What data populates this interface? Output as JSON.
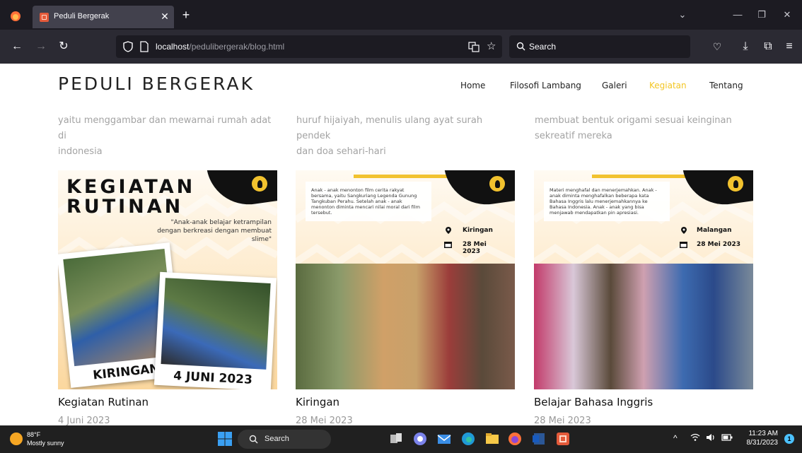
{
  "browser": {
    "tab_title": "Peduli Bergerak",
    "url_host": "localhost",
    "url_path": "/pedulibergerak/blog.html",
    "search_placeholder": "Search"
  },
  "site": {
    "brand": "PEDULI BERGERAK",
    "nav": [
      {
        "label": "Home",
        "active": false
      },
      {
        "label": "Filosofi Lambang",
        "active": false
      },
      {
        "label": "Galeri",
        "active": false
      },
      {
        "label": "Kegiatan",
        "active": true
      },
      {
        "label": "Tentang",
        "active": false
      }
    ],
    "prev_texts": [
      [
        "yaitu menggambar dan mewarnai rumah adat di",
        "indonesia"
      ],
      [
        "huruf hijaiyah, menulis ulang ayat surah pendek",
        "dan doa sehari-hari"
      ],
      [
        "membuat bentuk origami sesuai keinginan",
        "sekreatif mereka"
      ]
    ],
    "cards": [
      {
        "title": "Kegiatan Rutinan",
        "date": "4 Juni 2023",
        "poster": {
          "heading_1": "KEGIATAN",
          "heading_2": "RUTINAN",
          "quote": "\"Anak-anak belajar ketrampilan dengan berkreasi dengan membuat slime\"",
          "caption_left": "KIRINGAN",
          "caption_right": "4 JUNI 2023"
        }
      },
      {
        "title": "Kiringan",
        "date": "28 Mei 2023",
        "poster": {
          "note": "Anak - anak menonton film cerita rakyat bersama, yaitu Sangkuriang Legenda Gunung Tangkuban Perahu. Setelah anak - anak menonton diminta mencari nilai moral dari film tersebut.",
          "location": "Kiringan",
          "date": "28 Mei 2023"
        }
      },
      {
        "title": "Belajar Bahasa Inggris",
        "date": "28 Mei 2023",
        "poster": {
          "note": "Materi menghafal dan menerjemahkan. Anak - anak diminta menghafalkan beberapa kata Bahasa Inggris lalu menerjemahkannya ke Bahasa Indonesia. Anak - anak yang bisa menjawab mendapatkan pin apresiasi.",
          "location": "Malangan",
          "date": "28 Mei 2023"
        }
      }
    ]
  },
  "taskbar": {
    "temperature": "88°F",
    "condition": "Mostly sunny",
    "search_label": "Search",
    "time": "11:23 AM",
    "date": "8/31/2023",
    "notification_count": "1"
  }
}
